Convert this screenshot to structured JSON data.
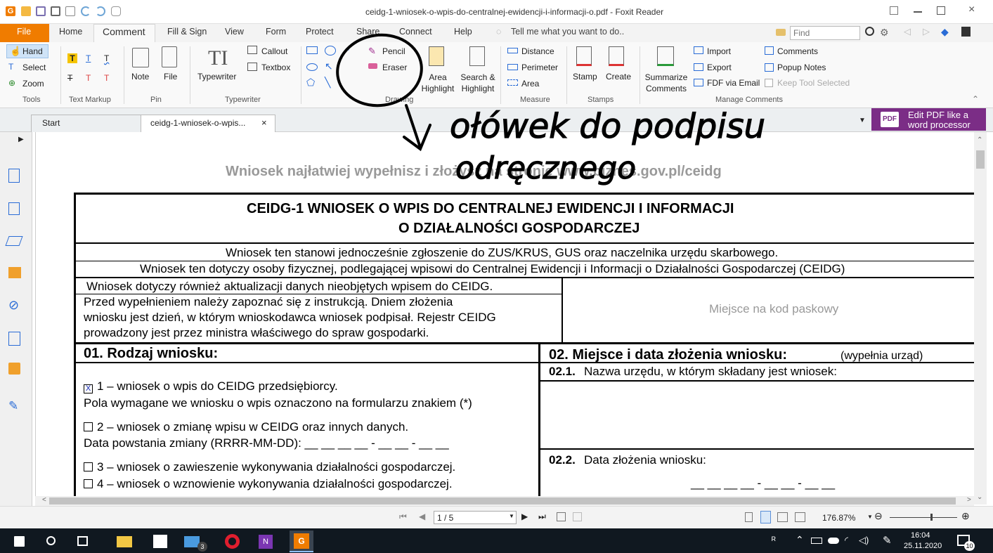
{
  "window": {
    "title": "ceidg-1-wniosek-o-wpis-do-centralnej-ewidencji-i-informacji-o.pdf - Foxit Reader"
  },
  "menu_tabs": [
    "File",
    "Home",
    "Comment",
    "Fill & Sign",
    "View",
    "Form",
    "Protect",
    "Share",
    "Connect",
    "Help"
  ],
  "tell_me": "Tell me what you want to do..",
  "find_placeholder": "Find",
  "ribbon": {
    "hand": "Hand",
    "select": "Select",
    "zoom": "Zoom",
    "note": "Note",
    "file": "File",
    "typewriter": "Typewriter",
    "callout": "Callout",
    "textbox": "Textbox",
    "pencil": "Pencil",
    "eraser": "Eraser",
    "area_highlight": "Area Highlight",
    "search_highlight": "Search & Highlight",
    "distance": "Distance",
    "perimeter": "Perimeter",
    "area": "Area",
    "stamp": "Stamp",
    "create": "Create",
    "summarize": "Summarize Comments",
    "import": "Import",
    "export": "Export",
    "fdf_email": "FDF via Email",
    "comments": "Comments",
    "popup_notes": "Popup Notes",
    "keep_tool": "Keep Tool Selected",
    "groups": {
      "tools": "Tools",
      "text_markup": "Text Markup",
      "pin": "Pin",
      "typewriter": "Typewriter",
      "drawing": "Drawing",
      "measure": "Measure",
      "stamps": "Stamps",
      "manage": "Manage Comments"
    }
  },
  "doc_tabs": {
    "start": "Start",
    "active": "ceidg-1-wniosek-o-wpis...",
    "close": "×",
    "promo_line1": "Edit PDF like a",
    "promo_line2": "word processor"
  },
  "annotation": {
    "line1": "ołówek do podpisu",
    "line2": "odręcznego"
  },
  "document": {
    "banner": "Wniosek najłatwiej wypełnisz i złożysz na stronie www.biznes.gov.pl/ceidg",
    "title1": "CEIDG-1 WNIOSEK O WPIS DO CENTRALNEJ EWIDENCJI I INFORMACJI",
    "title2": "O DZIAŁALNOŚCI GOSPODARCZEJ",
    "line_zus": "Wniosek ten stanowi jednocześnie zgłoszenie do ZUS/KRUS, GUS oraz naczelnika urzędu skarbowego.",
    "line_osoby": "Wniosek ten dotyczy osoby fizycznej, podlegającej wpisowi do Centralnej Ewidencji i Informacji o Działalności Gospodarczej (CEIDG)",
    "line_aktual": "Wniosek dotyczy również aktualizacji danych nieobjętych wpisem do CEIDG.",
    "instr1": "Przed  wypełnieniem  należy  zapoznać  się  z  instrukcją.  Dniem  złożenia",
    "instr2": "wniosku jest dzień, w którym wnioskodawca wniosek podpisał. Rejestr CEIDG",
    "instr3": "prowadzony jest przez ministra właściwego do spraw gospodarki.",
    "barcode": "Miejsce na kod paskowy",
    "s01_title": "01. Rodzaj wniosku:",
    "s02_title": "02. Miejsce i data złożenia wniosku:",
    "s02_note": "(wypełnia urząd)",
    "s021_num": "02.1.",
    "s021_text": "Nazwa urzędu, w którym składany jest wniosek:",
    "s022_num": "02.2.",
    "s022_text": "Data złożenia wniosku:",
    "date_blank": "__ __ __ __ - __ __ - __ __",
    "opt1_mark": "X",
    "opt1": "1 – wniosek o wpis do CEIDG przedsiębiorcy.",
    "opt1_note": "Pola wymagane we wniosku o wpis oznaczono na formularzu znakiem (*)",
    "opt2": "2 – wniosek o zmianę wpisu w CEIDG oraz innych danych.",
    "opt2_date": "Data powstania zmiany (RRRR-MM-DD):  __ __ __ __ - __ __ - __ __",
    "opt3": "3 – wniosek o zawieszenie wykonywania działalności gospodarczej.",
    "opt4": "4 – wniosek o wznowienie wykonywania działalności gospodarczej."
  },
  "status": {
    "page": "1 / 5",
    "zoom": "176.87%"
  },
  "taskbar": {
    "time": "16:04",
    "date": "25.11.2020",
    "mail_badge": "3",
    "notif_badge": "10"
  },
  "colors": {
    "accent": "#f07c00",
    "file_tab": "#f07c00",
    "promo": "#7b2d86",
    "taskbar": "#101820"
  }
}
